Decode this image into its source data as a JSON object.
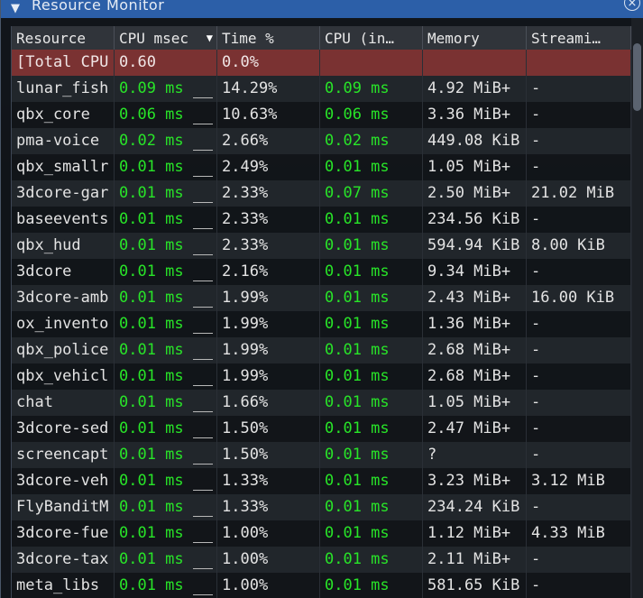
{
  "window": {
    "title": "Resource Monitor",
    "collapse_glyph": "▼",
    "close_glyph": "×"
  },
  "columns": [
    "Resource",
    "CPU msec",
    "Time %",
    "CPU (in…",
    "Memory",
    "Streami…"
  ],
  "sort_glyph": "▼",
  "total_row": {
    "resource": "[Total CPU",
    "cpu_msec": "0.60",
    "time_pct": "0.0%",
    "cpu_in": "",
    "memory": "",
    "streaming": ""
  },
  "rows": [
    {
      "resource": "lunar_fish",
      "cpu_msec": "0.09 ms",
      "time_pct": "14.29%",
      "cpu_in": "0.09 ms",
      "memory": "4.92 MiB+",
      "streaming": "-"
    },
    {
      "resource": "qbx_core",
      "cpu_msec": "0.06 ms",
      "time_pct": "10.63%",
      "cpu_in": "0.06 ms",
      "memory": "3.36 MiB+",
      "streaming": "-"
    },
    {
      "resource": "pma-voice",
      "cpu_msec": "0.02 ms",
      "time_pct": "2.66%",
      "cpu_in": "0.02 ms",
      "memory": "449.08 KiB",
      "streaming": "-"
    },
    {
      "resource": "qbx_smallr",
      "cpu_msec": "0.01 ms",
      "time_pct": "2.49%",
      "cpu_in": "0.01 ms",
      "memory": "1.05 MiB+",
      "streaming": "-"
    },
    {
      "resource": "3dcore-gar",
      "cpu_msec": "0.01 ms",
      "time_pct": "2.33%",
      "cpu_in": "0.07 ms",
      "memory": "2.50 MiB+",
      "streaming": "21.02 MiB"
    },
    {
      "resource": "baseevents",
      "cpu_msec": "0.01 ms",
      "time_pct": "2.33%",
      "cpu_in": "0.01 ms",
      "memory": "234.56 KiB",
      "streaming": "-"
    },
    {
      "resource": "qbx_hud",
      "cpu_msec": "0.01 ms",
      "time_pct": "2.33%",
      "cpu_in": "0.01 ms",
      "memory": "594.94 KiB",
      "streaming": "8.00 KiB"
    },
    {
      "resource": "3dcore",
      "cpu_msec": "0.01 ms",
      "time_pct": "2.16%",
      "cpu_in": "0.01 ms",
      "memory": "9.34 MiB+",
      "streaming": "-"
    },
    {
      "resource": "3dcore-amb",
      "cpu_msec": "0.01 ms",
      "time_pct": "1.99%",
      "cpu_in": "0.01 ms",
      "memory": "2.43 MiB+",
      "streaming": "16.00 KiB"
    },
    {
      "resource": "ox_invento",
      "cpu_msec": "0.01 ms",
      "time_pct": "1.99%",
      "cpu_in": "0.01 ms",
      "memory": "1.36 MiB+",
      "streaming": "-"
    },
    {
      "resource": "qbx_police",
      "cpu_msec": "0.01 ms",
      "time_pct": "1.99%",
      "cpu_in": "0.01 ms",
      "memory": "2.68 MiB+",
      "streaming": "-"
    },
    {
      "resource": "qbx_vehicl",
      "cpu_msec": "0.01 ms",
      "time_pct": "1.99%",
      "cpu_in": "0.01 ms",
      "memory": "2.68 MiB+",
      "streaming": "-"
    },
    {
      "resource": "chat",
      "cpu_msec": "0.01 ms",
      "time_pct": "1.66%",
      "cpu_in": "0.01 ms",
      "memory": "1.05 MiB+",
      "streaming": "-"
    },
    {
      "resource": "3dcore-sed",
      "cpu_msec": "0.01 ms",
      "time_pct": "1.50%",
      "cpu_in": "0.01 ms",
      "memory": "2.47 MiB+",
      "streaming": "-"
    },
    {
      "resource": "screencapt",
      "cpu_msec": "0.01 ms",
      "time_pct": "1.50%",
      "cpu_in": "0.01 ms",
      "memory": "?",
      "streaming": "-"
    },
    {
      "resource": "3dcore-veh",
      "cpu_msec": "0.01 ms",
      "time_pct": "1.33%",
      "cpu_in": "0.01 ms",
      "memory": "3.23 MiB+",
      "streaming": "3.12 MiB"
    },
    {
      "resource": "FlyBanditM",
      "cpu_msec": "0.01 ms",
      "time_pct": "1.33%",
      "cpu_in": "0.01 ms",
      "memory": "234.24 KiB",
      "streaming": "-"
    },
    {
      "resource": "3dcore-fue",
      "cpu_msec": "0.01 ms",
      "time_pct": "1.00%",
      "cpu_in": "0.01 ms",
      "memory": "1.12 MiB+",
      "streaming": "4.33 MiB"
    },
    {
      "resource": "3dcore-tax",
      "cpu_msec": "0.01 ms",
      "time_pct": "1.00%",
      "cpu_in": "0.01 ms",
      "memory": "2.11 MiB+",
      "streaming": "-"
    },
    {
      "resource": "meta_libs",
      "cpu_msec": "0.01 ms",
      "time_pct": "1.00%",
      "cpu_in": "0.01 ms",
      "memory": "581.65 KiB",
      "streaming": "-"
    }
  ],
  "colors": {
    "titlebar": "#2c5fa8",
    "total_row": "#7a3232",
    "cpu_value_green": "#28e428"
  }
}
